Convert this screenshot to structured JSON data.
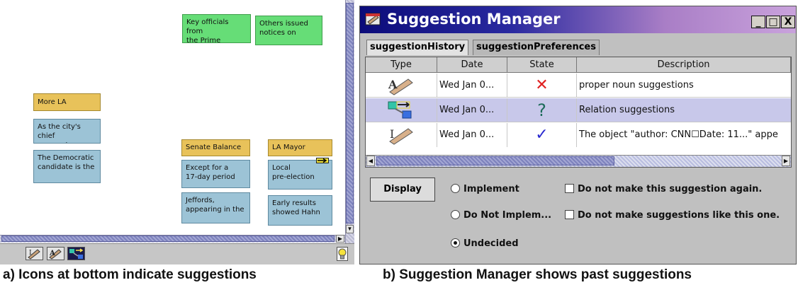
{
  "workspace": {
    "notes": [
      {
        "id": "key-officials",
        "text": "Key officials  from\nthe  Prime",
        "color": "green"
      },
      {
        "id": "others-issued",
        "text": "Others issued\nnotices  on",
        "color": "green"
      },
      {
        "id": "more-la",
        "text": "More LA",
        "color": "gold"
      },
      {
        "id": "city-chief",
        "text": "As the city's  chief\nprosecutor  Hahn",
        "color": "blue"
      },
      {
        "id": "democratic",
        "text": "The Democratic\ncandidate  is the",
        "color": "blue"
      },
      {
        "id": "senate-balance",
        "text": "Senate  Balance",
        "color": "gold"
      },
      {
        "id": "la-mayor",
        "text": "LA Mayor",
        "color": "gold"
      },
      {
        "id": "except-for",
        "text": "Except for a\n17-day period",
        "color": "blue"
      },
      {
        "id": "local-pre",
        "text": "Local\npre-election",
        "color": "blue"
      },
      {
        "id": "jeffords",
        "text": "Jeffords,\nappearing  in the",
        "color": "blue"
      },
      {
        "id": "early-results",
        "text": "Early results\nshowed  Hahn",
        "color": "blue"
      }
    ],
    "tray_icons": [
      "pencil-icon",
      "proper-noun-icon",
      "relation-icon"
    ],
    "bulb_icon": "lightbulb-icon"
  },
  "manager": {
    "title": "Suggestion Manager",
    "window_buttons": {
      "minimize": "_",
      "maximize": "□",
      "close": "X"
    },
    "tabs": [
      {
        "label": "suggestionHistory",
        "active": true
      },
      {
        "label": "suggestionPreferences",
        "active": false
      }
    ],
    "columns": [
      "Type",
      "Date",
      "State",
      "Description"
    ],
    "rows": [
      {
        "type_icon": "proper-noun-icon",
        "date": "Wed Jan 0...",
        "state": "rejected",
        "state_glyph": "✕",
        "state_color": "#e02020",
        "description": "proper noun suggestions",
        "selected": false
      },
      {
        "type_icon": "relation-icon",
        "date": "Wed Jan 0...",
        "state": "undecided",
        "state_glyph": "?",
        "state_color": "#1d6b5a",
        "description": "Relation suggestions",
        "selected": true
      },
      {
        "type_icon": "pencil-icon",
        "date": "Wed Jan 0...",
        "state": "implemented",
        "state_glyph": "✓",
        "state_color": "#2a2ad0",
        "description": "The object \"author: CNN☐Date: 11...\" appe",
        "selected": false
      }
    ],
    "display_button": "Display",
    "radios": [
      {
        "label": "Implement",
        "checked": false
      },
      {
        "label": "Do Not Implem...",
        "checked": false
      },
      {
        "label": "Undecided",
        "checked": true
      }
    ],
    "checkboxes": [
      {
        "label": "Do not make this suggestion again.",
        "checked": false
      },
      {
        "label": "Do not make suggestions like this one.",
        "checked": false
      }
    ]
  },
  "captions": {
    "a": "a) Icons at bottom indicate suggestions",
    "b": "b) Suggestion Manager shows past suggestions"
  }
}
